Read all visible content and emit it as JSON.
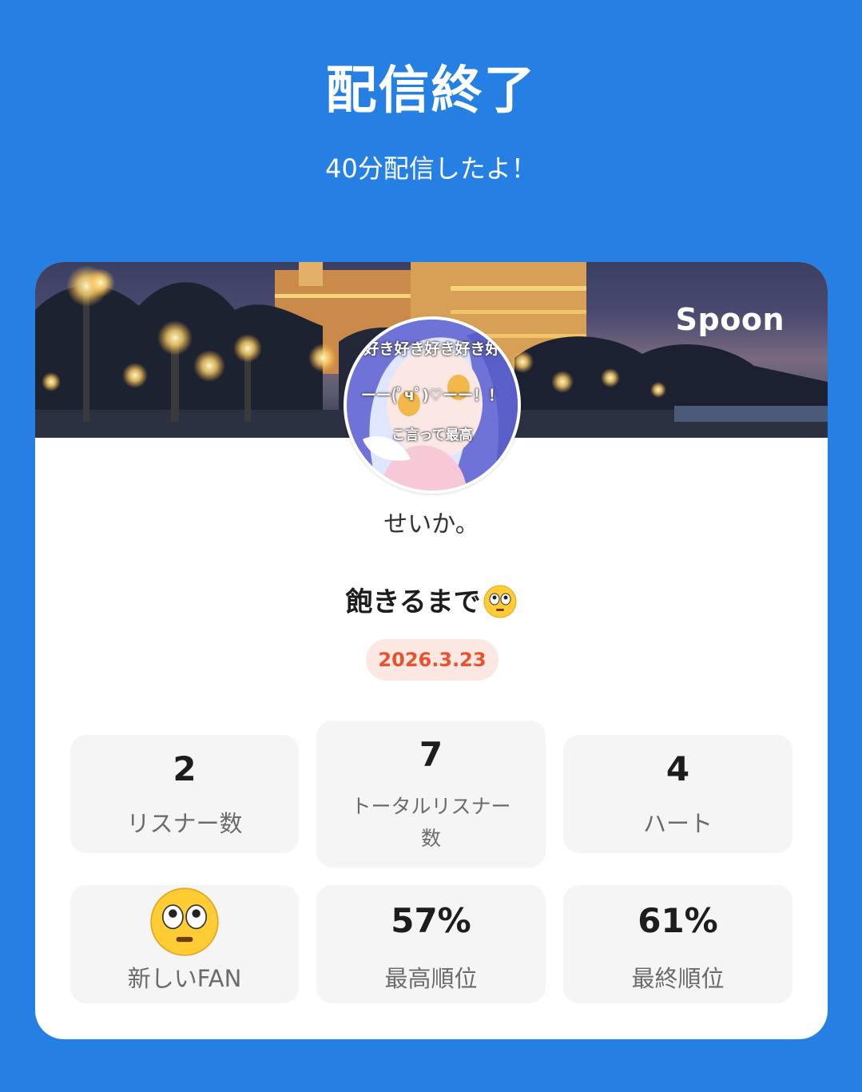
{
  "header": {
    "title": "配信終了",
    "subtitle": "40分配信したよ！"
  },
  "card": {
    "brand": "Spoon",
    "avatar": {
      "text_line1": "好き好き好き好き好",
      "text_line2": "ーー(ﾟчﾟ)♡ーー！！",
      "text_line3": "こ言って最高"
    },
    "username": "せいか。",
    "cast_title": "飽きるまで",
    "cast_title_emoji": "flushed-face-icon",
    "date": "2026.3.23"
  },
  "stats": [
    {
      "value": "2",
      "label": "リスナー数"
    },
    {
      "value": "7",
      "label_line1": "トータルリスナー",
      "label_line2": "数"
    },
    {
      "value": "4",
      "label": "ハート"
    },
    {
      "icon": "flushed-face-icon",
      "label": "新しいFAN"
    },
    {
      "value": "57%",
      "label": "最高順位"
    },
    {
      "value": "61%",
      "label": "最終順位"
    }
  ],
  "colors": {
    "background": "#2680E4",
    "date_text": "#E6532E",
    "date_bg": "#FDE7E2",
    "stat_bg": "#F5F5F5"
  }
}
